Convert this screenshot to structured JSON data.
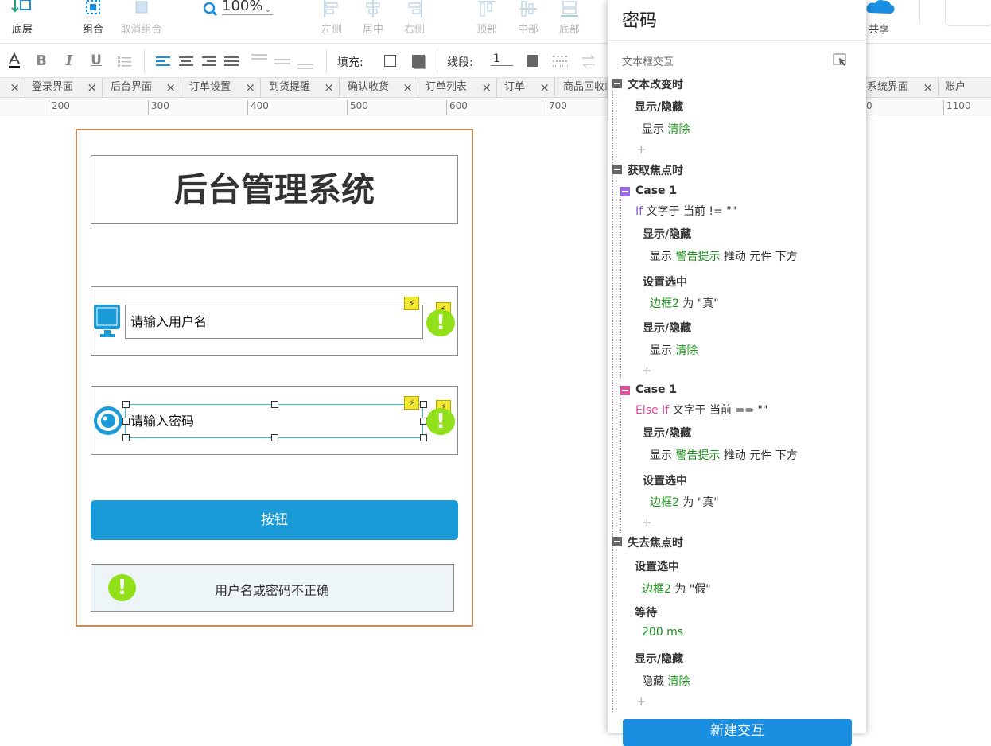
{
  "toolbar": {
    "bottom_layer": "底层",
    "group": "组合",
    "ungroup": "取消组合",
    "zoom": "100%",
    "align_left": "左侧",
    "align_center": "居中",
    "align_right": "右侧",
    "align_top": "顶部",
    "align_middle": "中部",
    "align_bottom": "底部",
    "share": "共享"
  },
  "formatbar": {
    "fill_label": "填充:",
    "stroke_label": "线段:",
    "stroke_width": "1"
  },
  "tabs": [
    "登录界面",
    "后台界面",
    "订单设置",
    "到货提醒",
    "确认收货",
    "订单列表",
    "订单",
    "商品回收站",
    "系统界面",
    "账户"
  ],
  "ruler": [
    "200",
    "300",
    "400",
    "500",
    "600",
    "700",
    "1100"
  ],
  "ruler_partial": "0",
  "canvas": {
    "title": "后台管理系统",
    "username_placeholder": "请输入用户名",
    "password_placeholder": "请输入密码",
    "bolt_glyph": "⚡",
    "warn_glyph": "!",
    "button_label": "按钮",
    "alert_text": "用户名或密码不正确"
  },
  "panel": {
    "title": "密码",
    "subtitle": "文本框交互",
    "plus": "+",
    "e1": {
      "title": "文本改变时",
      "a1_title": "显示/隐藏",
      "a1_verb": "显示",
      "a1_target": "清除"
    },
    "e2": {
      "title": "获取焦点时",
      "c1": {
        "name": "Case 1",
        "kw": "If",
        "cond": "文字于 当前 != \"\"",
        "a1_title": "显示/隐藏",
        "a1_verb": "显示",
        "a1_target": "警告提示",
        "a1_rest": "推动 元件 下方",
        "a2_title": "设置选中",
        "a2_target": "边框2",
        "a2_rest": "为 \"真\"",
        "a3_title": "显示/隐藏",
        "a3_verb": "显示",
        "a3_target": "清除"
      },
      "c2": {
        "name": "Case 1",
        "kw": "Else If",
        "cond": "文字于 当前 == \"\"",
        "a1_title": "显示/隐藏",
        "a1_verb": "显示",
        "a1_target": "警告提示",
        "a1_rest": "推动 元件 下方",
        "a2_title": "设置选中",
        "a2_target": "边框2",
        "a2_rest": "为 \"真\""
      }
    },
    "e3": {
      "title": "失去焦点时",
      "a1_title": "设置选中",
      "a1_target": "边框2",
      "a1_rest": "为 \"假\"",
      "a2_title": "等待",
      "a2_value": "200 ms",
      "a3_title": "显示/隐藏",
      "a3_verb": "隐藏",
      "a3_target": "清除"
    },
    "new_button": "新建交互"
  }
}
